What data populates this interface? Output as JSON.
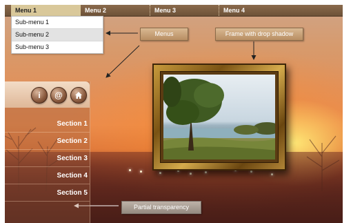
{
  "menu": {
    "items": [
      "Menu 1",
      "Menu 2",
      "Menu 3",
      "Menu 4"
    ],
    "active_index": 0,
    "submenu": [
      "Sub-menu 1",
      "Sub-menu 2",
      "Sub-menu 3"
    ],
    "highlighted_submenu_index": 1
  },
  "callouts": {
    "menus": "Menus",
    "frame": "Frame with drop shadow",
    "transparency": "Partial transparency"
  },
  "sidebar": {
    "icons": [
      "info-icon",
      "at-icon",
      "home-icon"
    ],
    "sections": [
      "Section 1",
      "Section 2",
      "Section 3",
      "Section 4",
      "Section 5"
    ]
  },
  "colors": {
    "menubar": "#6d5238",
    "active_menu": "#d9c89a",
    "callout": "#c9a47a",
    "frame_gold": "#c79a3c"
  }
}
